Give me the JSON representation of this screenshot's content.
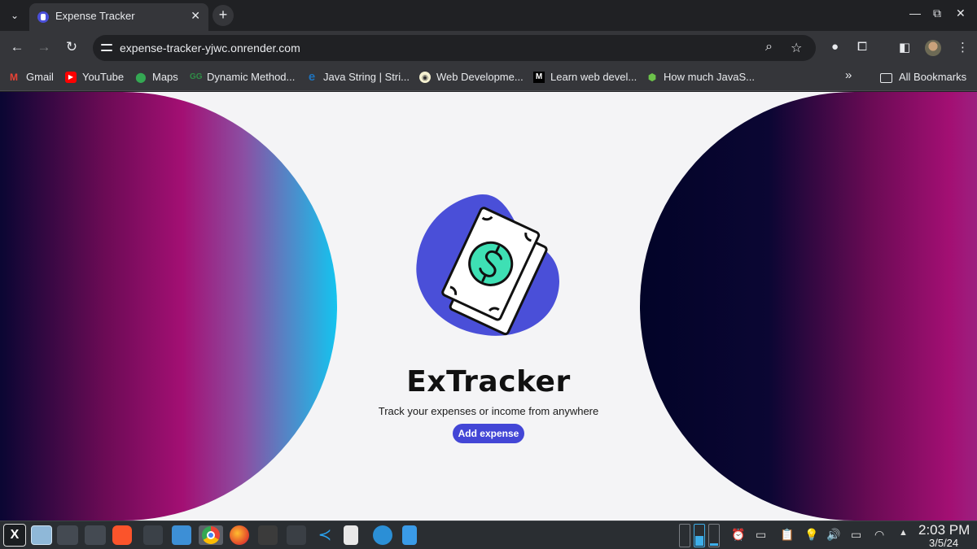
{
  "browser": {
    "tab": {
      "title": "Expense Tracker",
      "close": "✕"
    },
    "new_tab": "+",
    "window_controls": {
      "minimize": "—",
      "restore": "⧉",
      "close": "✕"
    },
    "url": "expense-tracker-yjwc.onrender.com",
    "bookmarks": [
      {
        "label": "Gmail",
        "icon": "gmail-icon"
      },
      {
        "label": "YouTube",
        "icon": "youtube-icon"
      },
      {
        "label": "Maps",
        "icon": "maps-icon"
      },
      {
        "label": "Dynamic Method...",
        "icon": "gfg-icon"
      },
      {
        "label": "Java String | Stri...",
        "icon": "edureka-icon"
      },
      {
        "label": "Web Developme...",
        "icon": "web-dev-icon"
      },
      {
        "label": "Learn web devel...",
        "icon": "mdn-icon"
      },
      {
        "label": "How much JavaS...",
        "icon": "node-icon"
      }
    ],
    "bookmarks_overflow": "»",
    "all_bookmarks": "All Bookmarks"
  },
  "page": {
    "brand": "ExTracker",
    "tagline": "Track your expenses or income from anywhere",
    "cta_label": "Add expense",
    "colors": {
      "accent": "#4346d6",
      "coin": "#3ee0b4",
      "background": "#f4f4f6"
    }
  },
  "taskbar": {
    "launcher": "X",
    "clock_time": "2:03 PM",
    "clock_date": "3/5/24"
  }
}
